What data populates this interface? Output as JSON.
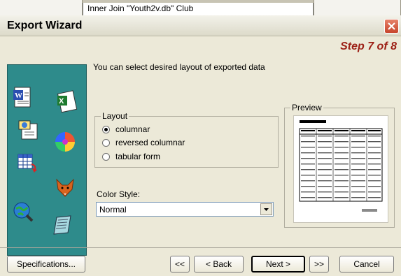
{
  "background": {
    "query_text": "Inner Join \"Youth2v.db\" Club"
  },
  "window": {
    "title": "Export Wizard",
    "step": "Step 7 of 8"
  },
  "intro": "You can select desired layout of exported data",
  "layout": {
    "legend": "Layout",
    "options": [
      {
        "label": "columnar",
        "checked": true
      },
      {
        "label": "reversed columnar",
        "checked": false
      },
      {
        "label": "tabular form",
        "checked": false
      }
    ]
  },
  "color_style": {
    "label": "Color Style:",
    "value": "Normal"
  },
  "preview": {
    "legend": "Preview"
  },
  "buttons": {
    "specifications": "Specifications...",
    "first": "<<",
    "back": "< Back",
    "next": "Next >",
    "last": ">>",
    "cancel": "Cancel"
  },
  "sidebar_icons": [
    "word-icon",
    "excel-icon",
    "html-icon",
    "palette-icon",
    "table-export-icon",
    "fox-icon",
    "search-globe-icon",
    "notepad-icon"
  ],
  "colors": {
    "sidebar": "#2e8b8b",
    "step_text": "#9c1f15",
    "close_button": "#d9573b",
    "window_bg": "#ece9d8"
  }
}
